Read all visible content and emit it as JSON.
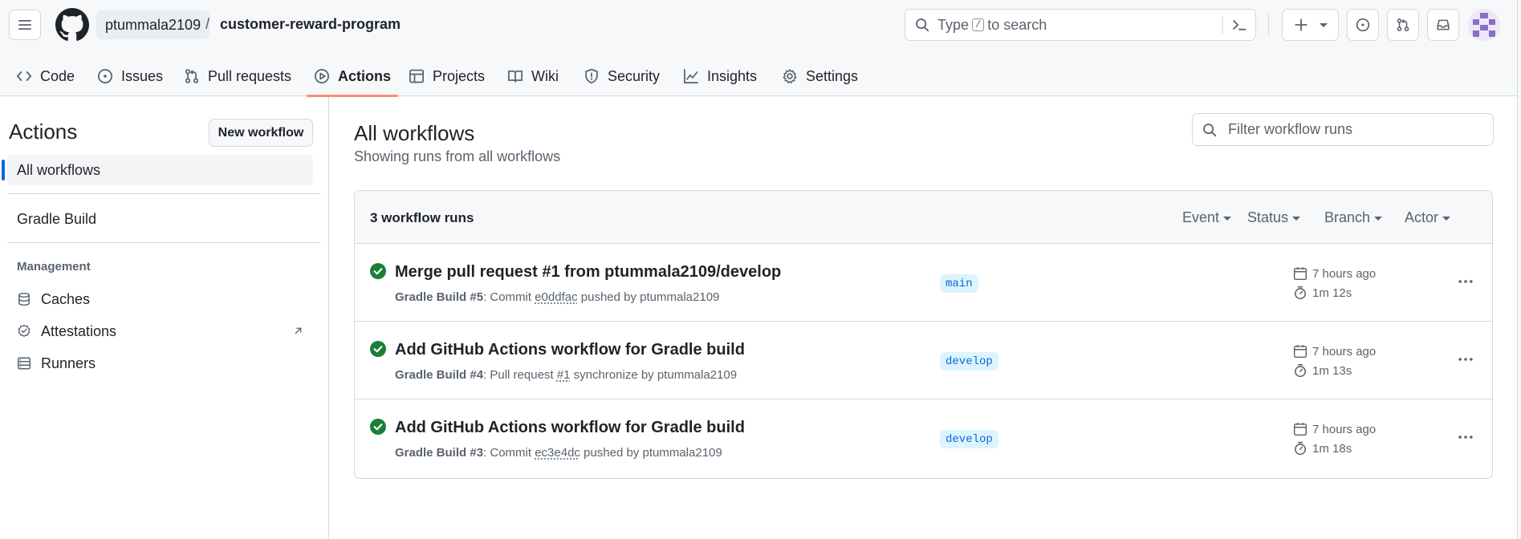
{
  "header": {
    "owner": "ptummala2109",
    "separator": "/",
    "repo": "customer-reward-program",
    "search": {
      "text_before": "Type",
      "key": "/",
      "text_after": "to search"
    }
  },
  "tabs": [
    {
      "label": "Code",
      "icon": "code-icon"
    },
    {
      "label": "Issues",
      "icon": "issue-icon"
    },
    {
      "label": "Pull requests",
      "icon": "pull-request-icon"
    },
    {
      "label": "Actions",
      "icon": "play-icon",
      "selected": true
    },
    {
      "label": "Projects",
      "icon": "table-icon"
    },
    {
      "label": "Wiki",
      "icon": "book-icon"
    },
    {
      "label": "Security",
      "icon": "shield-icon"
    },
    {
      "label": "Insights",
      "icon": "graph-icon"
    },
    {
      "label": "Settings",
      "icon": "gear-icon"
    }
  ],
  "sidebar": {
    "title": "Actions",
    "new_workflow_label": "New workflow",
    "all_workflows_label": "All workflows",
    "workflows": [
      "Gradle Build"
    ],
    "management_heading": "Management",
    "management_items": [
      {
        "label": "Caches",
        "icon": "database-icon"
      },
      {
        "label": "Attestations",
        "icon": "verified-icon",
        "external": true
      },
      {
        "label": "Runners",
        "icon": "server-icon"
      }
    ]
  },
  "main": {
    "title": "All workflows",
    "subtitle": "Showing runs from all workflows",
    "filter_placeholder": "Filter workflow runs",
    "runs_count": "3 workflow runs",
    "filters": [
      "Event",
      "Status",
      "Branch",
      "Actor"
    ],
    "runs": [
      {
        "title": "Merge pull request #1 from ptummala2109/develop",
        "workflow": "Gradle Build",
        "number": "#5",
        "meta_prefix": ": Commit",
        "ref": "e0ddfac",
        "meta_suffix": "pushed by ptummala2109",
        "branch": "main",
        "time": "7 hours ago",
        "duration": "1m 12s",
        "status": "success"
      },
      {
        "title": "Add GitHub Actions workflow for Gradle build",
        "workflow": "Gradle Build",
        "number": "#4",
        "meta_prefix": ": Pull request",
        "ref": "#1",
        "meta_suffix": "synchronize by ptummala2109",
        "branch": "develop",
        "time": "7 hours ago",
        "duration": "1m 13s",
        "status": "success"
      },
      {
        "title": "Add GitHub Actions workflow for Gradle build",
        "workflow": "Gradle Build",
        "number": "#3",
        "meta_prefix": ": Commit",
        "ref": "ec3e4dc",
        "meta_suffix": "pushed by ptummala2109",
        "branch": "develop",
        "time": "7 hours ago",
        "duration": "1m 18s",
        "status": "success"
      }
    ]
  },
  "colors": {
    "accent": "#0969da",
    "success": "#1a7f37",
    "selected_tab_underline": "#fd8c73",
    "branch_bg": "#ddf4ff"
  }
}
